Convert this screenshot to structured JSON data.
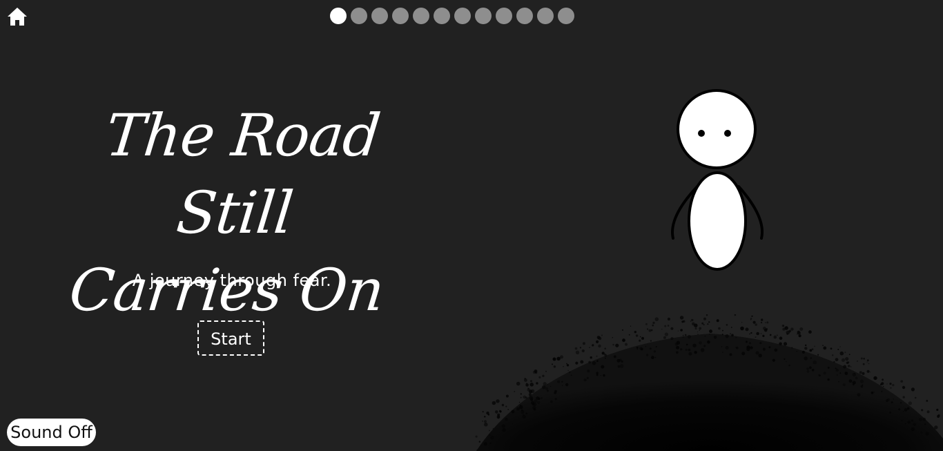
{
  "title_line1": "The Road Still",
  "title_line2": "Carries On",
  "subtitle": "A journey through fear.",
  "start_label": "Start",
  "sound_label": "Sound Off",
  "progress": {
    "total": 12,
    "current": 1
  },
  "icons": {
    "home": "home-icon"
  },
  "colors": {
    "background": "#212121",
    "dot_active": "#ffffff",
    "dot_inactive": "#8e8e8e",
    "hill": "#0a0a0a"
  }
}
